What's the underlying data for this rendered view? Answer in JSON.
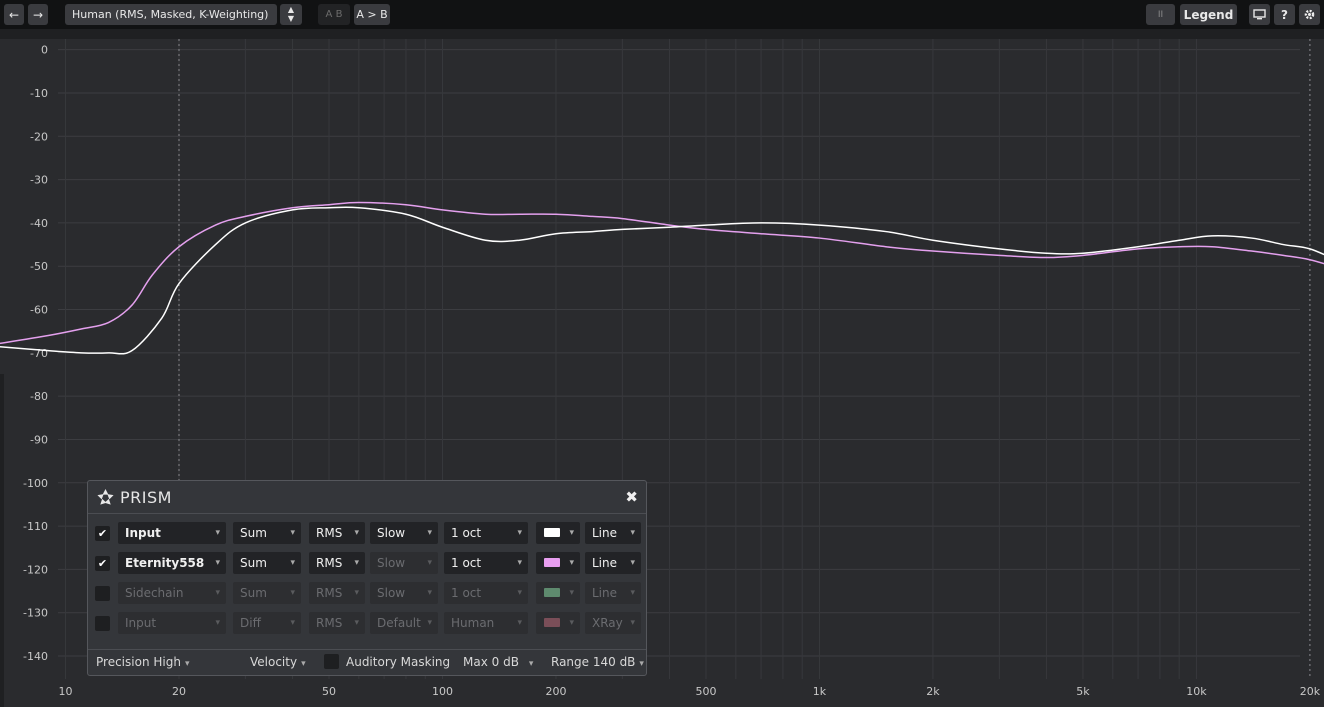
{
  "toolbar": {
    "back_label": "←",
    "forward_label": "→",
    "preset": "Human (RMS, Masked, K-Weighting)",
    "stepper_up": "▲",
    "stepper_down": "▼",
    "ab_label": "A B",
    "a_to_b_label": "A > B",
    "pause_label": "II",
    "legend_label": "Legend",
    "monitor_icon": "monitor-icon",
    "help_label": "?",
    "settings_icon": "gear-icon"
  },
  "chart_data": {
    "type": "line",
    "xscale": "log",
    "xlim": [
      6.5,
      28000
    ],
    "ylim": [
      -143,
      2
    ],
    "grid": true,
    "y_ticks": [
      0,
      -10,
      -20,
      -30,
      -40,
      -50,
      -60,
      -70,
      -80,
      -90,
      -100,
      -110,
      -120,
      -130,
      -140
    ],
    "x_ticks": [
      10,
      20,
      50,
      100,
      200,
      500,
      1000,
      2000,
      5000,
      10000,
      20000
    ],
    "x_tick_labels": [
      "10",
      "20",
      "50",
      "100",
      "200",
      "500",
      "1k",
      "2k",
      "5k",
      "10k",
      "20k"
    ],
    "series": [
      {
        "name": "Input",
        "color": "#ffffff",
        "x": [
          6.5,
          9,
          11,
          13,
          15,
          18,
          20,
          25,
          30,
          40,
          50,
          60,
          80,
          100,
          130,
          160,
          200,
          250,
          300,
          400,
          500,
          700,
          1000,
          1500,
          2000,
          3000,
          4000,
          5000,
          7000,
          9000,
          11000,
          14000,
          17000,
          20000,
          24000,
          28000
        ],
        "values": [
          -68.5,
          -69.5,
          -70,
          -70,
          -69.5,
          -62,
          -54,
          -45,
          -40,
          -37,
          -36.5,
          -36.5,
          -38,
          -41,
          -44,
          -44,
          -42.5,
          -42,
          -41.5,
          -41,
          -40.5,
          -40,
          -40.5,
          -42,
          -44,
          -46,
          -47,
          -47,
          -45.5,
          -44,
          -43,
          -43.5,
          -45,
          -46,
          -49,
          -52
        ]
      },
      {
        "name": "Eternity558",
        "color": "#e4a0ee",
        "x": [
          6.5,
          9,
          11,
          13,
          15,
          17,
          20,
          25,
          30,
          40,
          50,
          60,
          80,
          100,
          130,
          160,
          200,
          250,
          300,
          400,
          500,
          700,
          1000,
          1500,
          2000,
          3000,
          4000,
          5000,
          7000,
          9000,
          11000,
          14000,
          17000,
          20000,
          24000,
          28000
        ],
        "values": [
          -68,
          -66,
          -64.5,
          -63,
          -59,
          -52,
          -45.5,
          -40.5,
          -38.5,
          -36.5,
          -35.8,
          -35.3,
          -35.8,
          -37,
          -38,
          -38,
          -38,
          -38.5,
          -39,
          -40.5,
          -41.5,
          -42.5,
          -43.5,
          -45.5,
          -46.5,
          -47.5,
          -48,
          -47.5,
          -46,
          -45.5,
          -45.5,
          -46.5,
          -47.5,
          -48.5,
          -50.5,
          -52
        ]
      }
    ]
  },
  "prism": {
    "title": "PRISM",
    "close_label": "✖",
    "rows": [
      {
        "checked": "✔",
        "source": "Input",
        "mode": "Sum",
        "type": "RMS",
        "speed": "Slow",
        "smoothing": "1 oct",
        "color": "#ffffff",
        "style": "Line",
        "enabled": true
      },
      {
        "checked": "✔",
        "source": "Eternity558",
        "mode": "Sum",
        "type": "RMS",
        "speed": "Slow",
        "smoothing": "1 oct",
        "color": "#e89ef0",
        "style": "Line",
        "enabled": true
      },
      {
        "checked": "",
        "source": "Sidechain",
        "mode": "Sum",
        "type": "RMS",
        "speed": "Slow",
        "smoothing": "1 oct",
        "color": "#5e8a6e",
        "style": "Line",
        "enabled": false
      },
      {
        "checked": "",
        "source": "Input",
        "mode": "Diff",
        "type": "RMS",
        "speed": "Default",
        "smoothing": "Human",
        "color": "#7a4e58",
        "style": "XRay",
        "enabled": false
      }
    ],
    "footer": {
      "precision": "Precision High",
      "velocity": "Velocity",
      "masking": "Auditory Masking",
      "max": "Max  0 dB",
      "range": "Range  140 dB"
    }
  }
}
